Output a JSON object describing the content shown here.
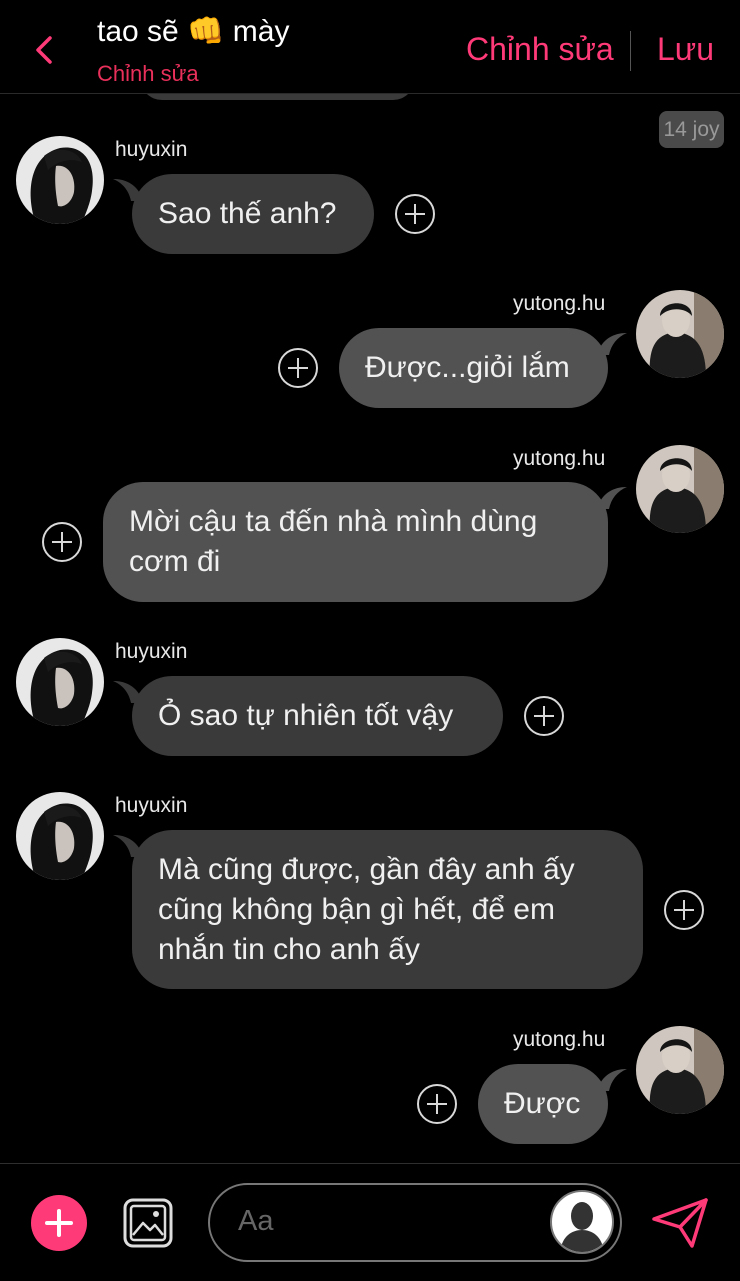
{
  "header": {
    "title": "tao sẽ",
    "title_emoji": "👊",
    "title_suffix": "mày",
    "subtitle": "Chỉnh sửa",
    "edit_label": "Chỉnh sửa",
    "save_label": "Lưu",
    "accent_color": "#ff3a78"
  },
  "time_badge": "14 joy",
  "messages": [
    {
      "sender": "huyuxin",
      "side": "left",
      "text": [
        "Sao thế anh?"
      ]
    },
    {
      "sender": "yutong.hu",
      "side": "right",
      "text": [
        "Được...giỏi lắm"
      ]
    },
    {
      "sender": "yutong.hu",
      "side": "right",
      "text": [
        "Mời cậu ta đến nhà mình dùng",
        "cơm đi"
      ]
    },
    {
      "sender": "huyuxin",
      "side": "left",
      "text": [
        "Ỏ sao tự nhiên tốt vậy"
      ]
    },
    {
      "sender": "huyuxin",
      "side": "left",
      "text": [
        "Mà cũng được, gần đây anh ấy",
        "cũng không bận gì hết, để em",
        "nhắn tin cho anh ấy"
      ]
    },
    {
      "sender": "yutong.hu",
      "side": "right",
      "text": [
        "Được"
      ]
    }
  ],
  "composer": {
    "placeholder": "Aa"
  },
  "icons": {
    "back": "chevron-left-icon",
    "add": "plus-icon",
    "image": "image-icon",
    "profile": "profile-icon",
    "send": "send-icon",
    "react": "add-reaction-icon"
  }
}
